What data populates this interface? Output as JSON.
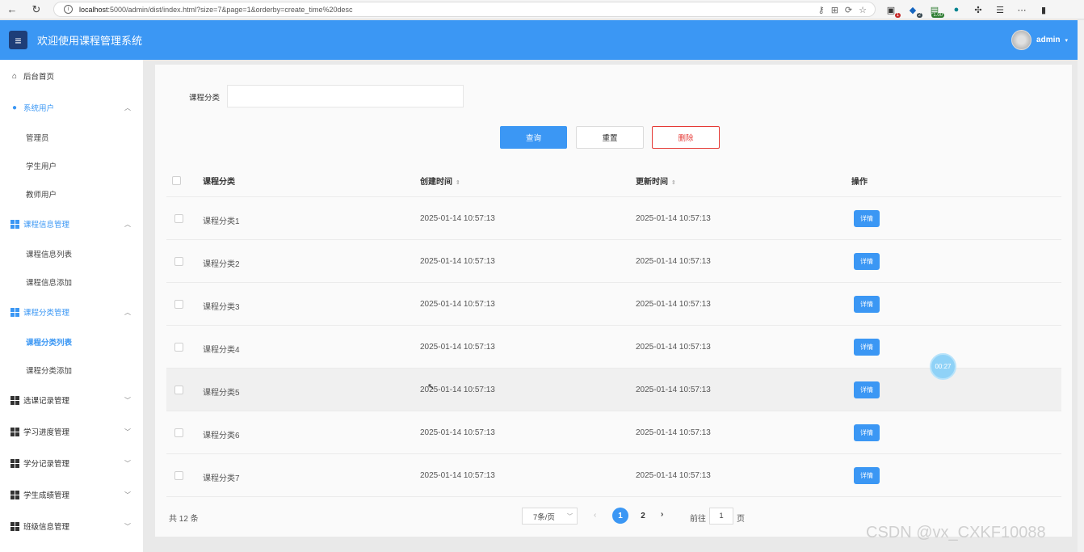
{
  "browser": {
    "url_host": "localhost",
    "url_rest": ":5000/admin/dist/index.html?size=7&page=1&orderby=create_time%20desc",
    "ext_badges": [
      "1",
      "2",
      "1.00"
    ]
  },
  "header": {
    "title": "欢迎使用课程管理系统",
    "user": "admin"
  },
  "sidebar": {
    "home": "后台首页",
    "groups": [
      {
        "label": "系统用户",
        "children": [
          "管理员",
          "学生用户",
          "教师用户"
        ]
      },
      {
        "label": "课程信息管理",
        "children": [
          "课程信息列表",
          "课程信息添加"
        ]
      },
      {
        "label": "课程分类管理",
        "children": [
          "课程分类列表",
          "课程分类添加"
        ]
      },
      {
        "label": "选课记录管理"
      },
      {
        "label": "学习进度管理"
      },
      {
        "label": "学分记录管理"
      },
      {
        "label": "学生成绩管理"
      },
      {
        "label": "班级信息管理"
      }
    ]
  },
  "filter": {
    "label": "课程分类",
    "value": ""
  },
  "buttons": {
    "search": "查询",
    "reset": "重置",
    "delete": "删除"
  },
  "table": {
    "headers": [
      "课程分类",
      "创建时间",
      "更新时间",
      "操作"
    ],
    "sort_icon": "⇕",
    "detail_label": "详情",
    "rows": [
      {
        "name": "课程分类1",
        "created": "2025-01-14 10:57:13",
        "updated": "2025-01-14 10:57:13"
      },
      {
        "name": "课程分类2",
        "created": "2025-01-14 10:57:13",
        "updated": "2025-01-14 10:57:13"
      },
      {
        "name": "课程分类3",
        "created": "2025-01-14 10:57:13",
        "updated": "2025-01-14 10:57:13"
      },
      {
        "name": "课程分类4",
        "created": "2025-01-14 10:57:13",
        "updated": "2025-01-14 10:57:13"
      },
      {
        "name": "课程分类5",
        "created": "2025-01-14 10:57:13",
        "updated": "2025-01-14 10:57:13"
      },
      {
        "name": "课程分类6",
        "created": "2025-01-14 10:57:13",
        "updated": "2025-01-14 10:57:13"
      },
      {
        "name": "课程分类7",
        "created": "2025-01-14 10:57:13",
        "updated": "2025-01-14 10:57:13"
      }
    ]
  },
  "pager": {
    "total": "共 12 条",
    "page_size": "7条/页",
    "pages": [
      "1",
      "2"
    ],
    "goto_label": "前往",
    "goto_value": "1",
    "goto_suffix": "页"
  },
  "overlay": {
    "timer": "00:27",
    "watermark": "CSDN @vx_CXKF10088"
  },
  "colors": {
    "accent": "#3b97f4",
    "header_toggle": "#1e3e78",
    "danger": "#e53935"
  }
}
